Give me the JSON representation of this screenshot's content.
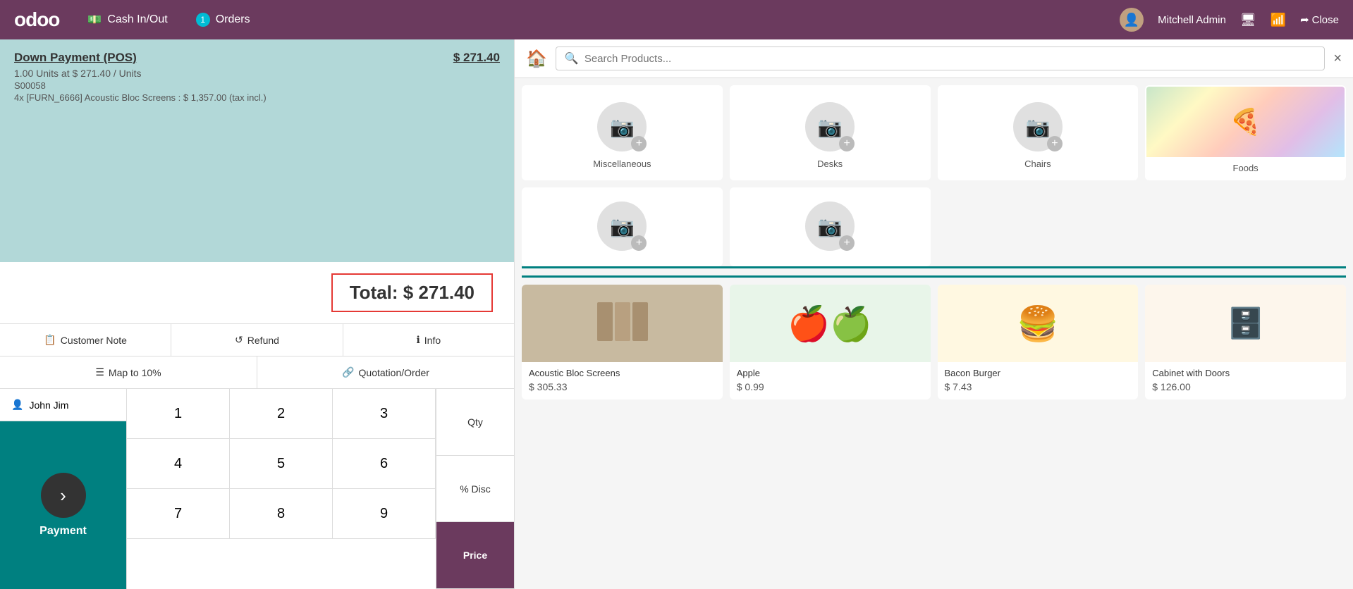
{
  "topnav": {
    "logo": "odoo",
    "cash_in_out_label": "Cash In/Out",
    "orders_label": "Orders",
    "orders_badge": "1",
    "user_name": "Mitchell Admin",
    "close_label": "Close"
  },
  "order": {
    "title": "Down Payment (POS)",
    "title_price": "$ 271.40",
    "detail1": "1.00  Units at $ 271.40 / Units",
    "detail2": "S00058",
    "detail3": "4x    [FURN_6666] Acoustic Bloc Screens   :  $ 1,357.00 (tax incl.)",
    "total_label": "Total: $ 271.40"
  },
  "action_buttons": {
    "customer_note": "Customer Note",
    "refund": "Refund",
    "info": "Info",
    "map_to_10": "Map to 10%",
    "quotation_order": "Quotation/Order"
  },
  "numpad": {
    "keys": [
      "1",
      "2",
      "3",
      "4",
      "5",
      "6",
      "7",
      "8",
      "9"
    ],
    "mode_qty": "Qty",
    "mode_disc": "% Disc",
    "mode_price": "Price"
  },
  "customer": {
    "name": "John Jim"
  },
  "payment": {
    "label": "Payment"
  },
  "search": {
    "placeholder": "Search Products...",
    "clear": "×"
  },
  "categories": [
    {
      "id": "miscellaneous",
      "label": "Miscellaneous",
      "type": "placeholder"
    },
    {
      "id": "desks",
      "label": "Desks",
      "type": "placeholder"
    },
    {
      "id": "chairs",
      "label": "Chairs",
      "type": "placeholder"
    },
    {
      "id": "foods",
      "label": "Foods",
      "type": "image"
    }
  ],
  "extra_categories": [
    {
      "id": "cat5",
      "label": "",
      "type": "placeholder"
    },
    {
      "id": "cat6",
      "label": "",
      "type": "placeholder"
    }
  ],
  "products": [
    {
      "id": "acoustic",
      "name": "Acoustic Bloc Screens",
      "price": "$ 305.33",
      "emoji": "🔲",
      "bg": "acoustic"
    },
    {
      "id": "apple",
      "name": "Apple",
      "price": "$ 0.99",
      "emoji": "🍎",
      "bg": "apple"
    },
    {
      "id": "bacon-burger",
      "name": "Bacon Burger",
      "price": "$ 7.43",
      "emoji": "🍔",
      "bg": "burger"
    },
    {
      "id": "cabinet-doors",
      "name": "Cabinet with Doors",
      "price": "$ 126.00",
      "emoji": "🗄",
      "bg": "cabinet"
    }
  ]
}
